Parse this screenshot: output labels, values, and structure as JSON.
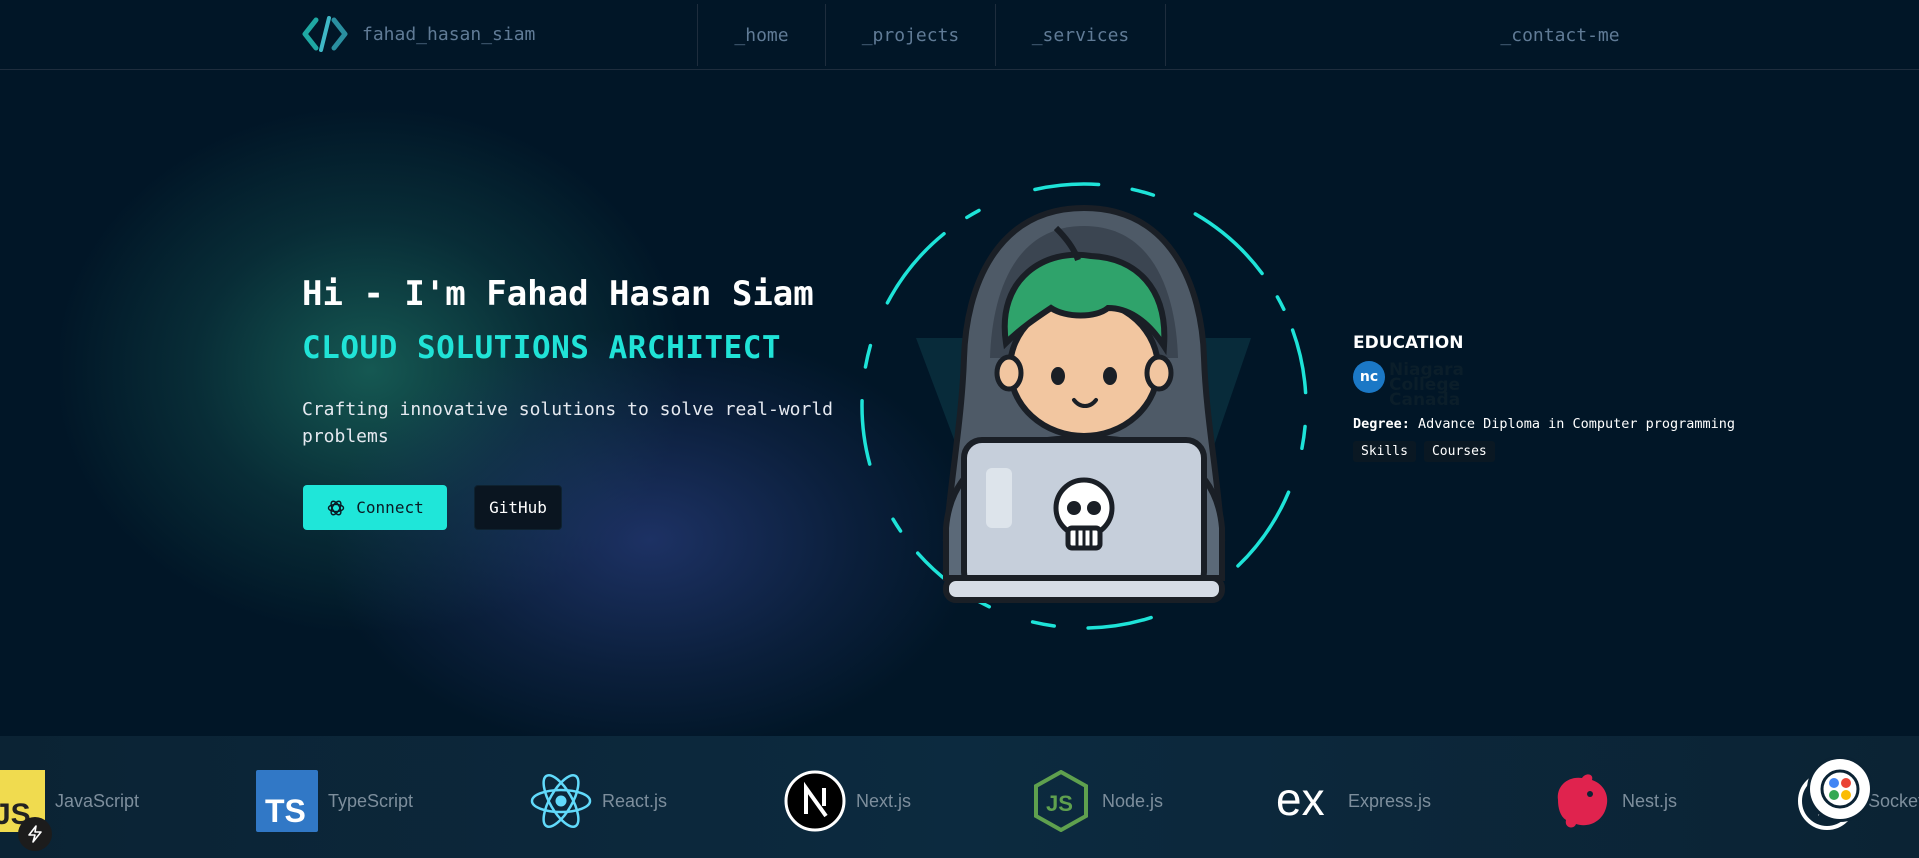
{
  "nav": {
    "brand": "fahad_hasan_siam",
    "items": [
      {
        "label": "_home"
      },
      {
        "label": "_projects"
      },
      {
        "label": "_services"
      }
    ],
    "contact": "_contact-me"
  },
  "hero": {
    "title": "Hi - I'm Fahad Hasan Siam",
    "role": "CLOUD SOLUTIONS ARCHITECT",
    "description": "Crafting innovative solutions to solve real-world problems",
    "connect_label": "Connect",
    "github_label": "GitHub"
  },
  "education": {
    "title": "EDUCATION",
    "logo_initials": "nc",
    "logo_lines": [
      "Niagara",
      "College",
      "Canada"
    ],
    "degree_label": "Degree:",
    "degree_value": "Advance Diploma in Computer programming",
    "tabs": [
      "Skills",
      "Courses"
    ]
  },
  "tech_stack": [
    {
      "name": "JavaScript",
      "icon": "javascript-icon"
    },
    {
      "name": "TypeScript",
      "icon": "typescript-icon"
    },
    {
      "name": "React.js",
      "icon": "react-icon"
    },
    {
      "name": "Next.js",
      "icon": "nextjs-icon"
    },
    {
      "name": "Node.js",
      "icon": "nodejs-icon"
    },
    {
      "name": "Express.js",
      "icon": "express-icon"
    },
    {
      "name": "Nest.js",
      "icon": "nestjs-icon"
    },
    {
      "name": "Socket",
      "icon": "socketio-icon"
    }
  ],
  "colors": {
    "background": "#011627",
    "accent": "#1fe6d9",
    "nav_text": "#607b96"
  }
}
